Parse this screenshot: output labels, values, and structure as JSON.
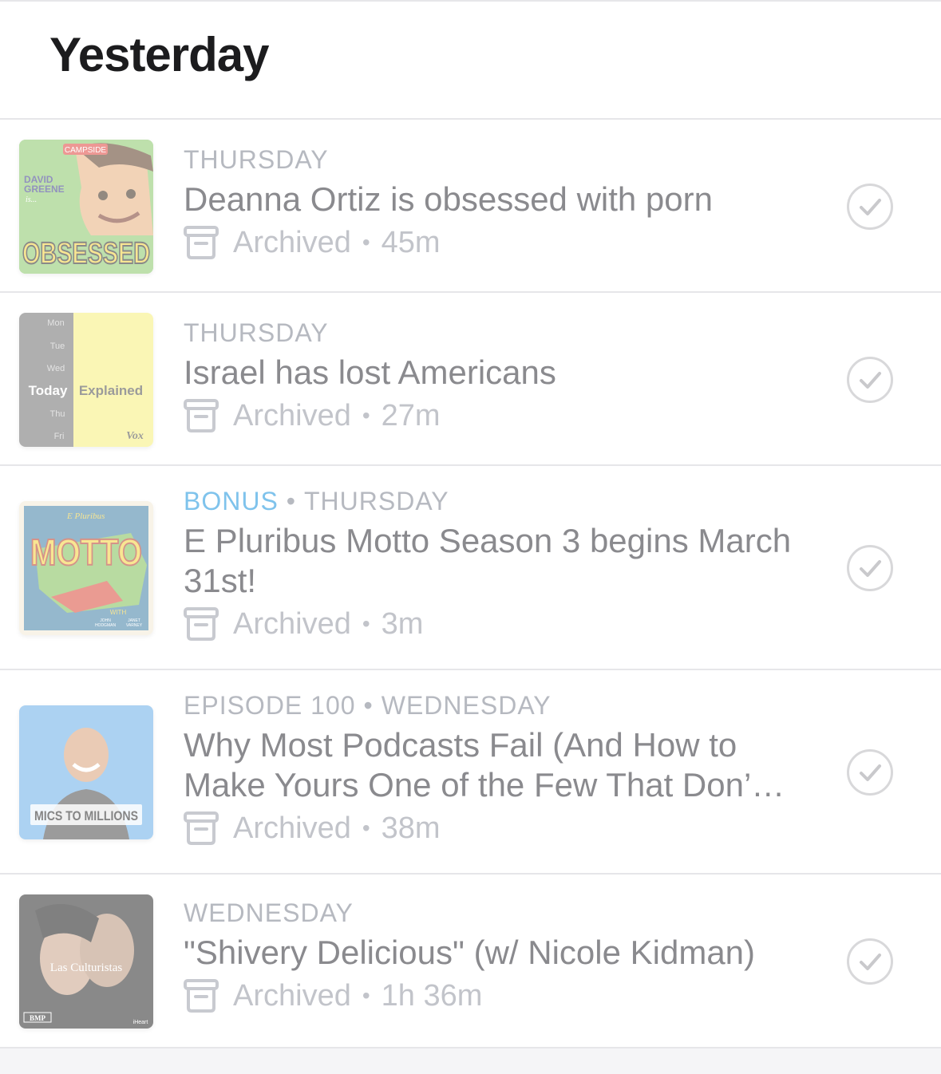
{
  "header": {
    "title": "Yesterday"
  },
  "episodes": [
    {
      "badge": "",
      "day": "THURSDAY",
      "title": "Deanna Ortiz is obsessed with porn",
      "status": "Archived",
      "duration": "45m",
      "art": {
        "top_tag": "CAMPSIDE",
        "name_line1": "DAVID",
        "name_line2": "GREENE",
        "is_text": "is...",
        "show_word": "OBSESSED"
      }
    },
    {
      "badge": "",
      "day": "THURSDAY",
      "title": "Israel has lost Americans",
      "status": "Archived",
      "duration": "27m",
      "art": {
        "days": [
          "Mon",
          "Tue",
          "Wed",
          "Thu",
          "Fri"
        ],
        "today": "Today",
        "explained": "Explained",
        "brand": "Vox"
      }
    },
    {
      "badge": "BONUS",
      "day": "THURSDAY",
      "title": "E Pluribus Motto Season 3 begins March 31st!",
      "status": "Archived",
      "duration": "3m",
      "art": {
        "script": "E Pluribus",
        "word": "MOTTO",
        "with": "WITH",
        "host1_first": "JOHN",
        "host1_last": "HODGMAN",
        "host2_first": "JANET",
        "host2_last": "VARNEY"
      }
    },
    {
      "badge": "EPISODE 100",
      "day": "WEDNESDAY",
      "title": "Why Most Podcasts Fail (And How to Make Yours One of the Few That Don’…",
      "status": "Archived",
      "duration": "38m",
      "art": {
        "show_word": "MICS TO MILLIONS"
      }
    },
    {
      "badge": "",
      "day": "WEDNESDAY",
      "title": "\"Shivery Delicious\" (w/ Nicole Kidman)",
      "status": "Archived",
      "duration": "1h 36m",
      "art": {
        "show_word": "Las Culturistas",
        "corner_left": "BMP",
        "corner_right": "iHeart"
      }
    }
  ],
  "colors": {
    "bonus": "#7fc3ec",
    "meta": "#b6b9c0",
    "title": "#8a8a8e"
  }
}
